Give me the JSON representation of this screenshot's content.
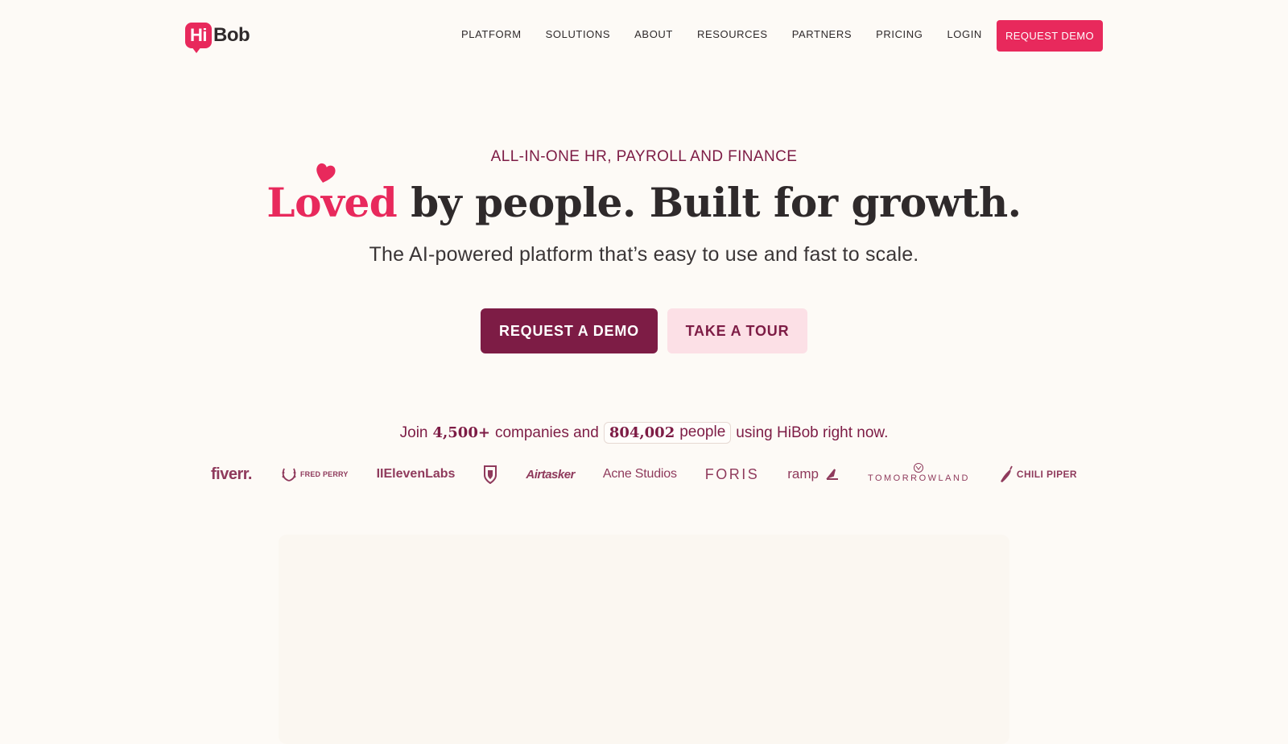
{
  "brand": {
    "logo_hi": "Hi",
    "logo_bob": "Bob"
  },
  "nav": {
    "items": [
      {
        "label": "PLATFORM"
      },
      {
        "label": "SOLUTIONS"
      },
      {
        "label": "ABOUT"
      },
      {
        "label": "RESOURCES"
      },
      {
        "label": "PARTNERS"
      },
      {
        "label": "PRICING"
      },
      {
        "label": "LOGIN"
      }
    ],
    "cta_label": "REQUEST DEMO"
  },
  "hero": {
    "eyebrow": "ALL-IN-ONE HR, PAYROLL AND FINANCE",
    "title_highlight": "Loved",
    "title_rest": " by people. Built for growth.",
    "subtitle": "The AI-powered platform that’s easy to use and fast to scale.",
    "primary_cta": "REQUEST A DEMO",
    "secondary_cta": "TAKE A TOUR"
  },
  "social_proof": {
    "prefix": "Join",
    "companies_count": "4,500+",
    "companies_text": "companies and",
    "people_count": "804,002",
    "people_text": "people",
    "suffix": "using HiBob right now."
  },
  "customer_logos": [
    {
      "name": "fiverr."
    },
    {
      "name": "FRED PERRY"
    },
    {
      "name": "IIElevenLabs"
    },
    {
      "name": "Fulham crest"
    },
    {
      "name": "Airtasker"
    },
    {
      "name": "Acne Studios"
    },
    {
      "name": "FORIS"
    },
    {
      "name": "ramp"
    },
    {
      "name": "TOMORROWLAND"
    },
    {
      "name": "CHILI PIPER"
    }
  ],
  "colors": {
    "background": "#fdfaf6",
    "brand_pink": "#e8295c",
    "brand_burgundy": "#7d1c45",
    "secondary_button_bg": "#fce0e6",
    "text_dark": "#2f2a2b"
  }
}
